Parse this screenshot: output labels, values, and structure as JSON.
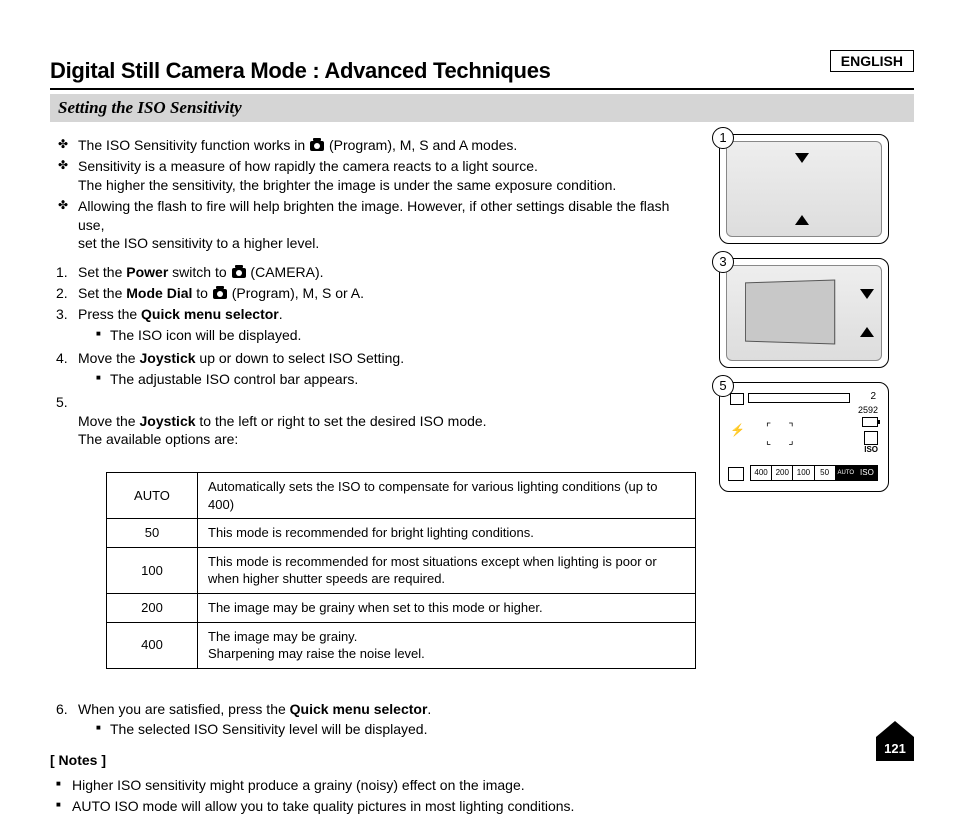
{
  "language_label": "ENGLISH",
  "title": "Digital Still Camera Mode : Advanced Techniques",
  "subhead": "Setting the ISO Sensitivity",
  "intro": [
    "The ISO Sensitivity function works in     (Program), M, S and A modes.",
    "Sensitivity is a measure of how rapidly the camera reacts to a light source.\nThe higher the sensitivity, the brighter the image is under the same exposure condition.",
    "Allowing the flash to fire will help brighten the image. However, if other settings disable the flash use,\nset the ISO sensitivity to a higher level."
  ],
  "steps": {
    "s1": {
      "pre": "Set the ",
      "b": "Power",
      "post": " switch to      (CAMERA)."
    },
    "s2": {
      "pre": "Set the ",
      "b": "Mode Dial",
      "post": " to      (Program), M, S or A."
    },
    "s3": {
      "pre": "Press the ",
      "b": "Quick menu selector",
      "post": ".",
      "sub": "The ISO icon will be displayed."
    },
    "s4": {
      "pre": "Move the ",
      "b": "Joystick",
      "post": " up or down to select ISO Setting.",
      "sub": "The adjustable ISO control bar appears."
    },
    "s5": {
      "pre": "Move the ",
      "b": "Joystick",
      "post": " to the left or right to set the desired ISO mode.\nThe available options are:"
    },
    "s6": {
      "pre": "When you are satisfied, press the ",
      "b": "Quick menu selector",
      "post": ".",
      "sub": "The selected ISO Sensitivity level will be displayed."
    }
  },
  "table": [
    {
      "k": "AUTO",
      "v": "Automatically sets the ISO to compensate for various lighting conditions (up to 400)"
    },
    {
      "k": "50",
      "v": "This mode is recommended for bright lighting conditions."
    },
    {
      "k": "100",
      "v": "This mode is recommended for most situations except when lighting is poor or when higher shutter speeds are required."
    },
    {
      "k": "200",
      "v": "The image may be grainy when set to this mode or higher."
    },
    {
      "k": "400",
      "v": "The image may be grainy.\nSharpening may raise the noise level."
    }
  ],
  "notes_head": "[ Notes ]",
  "notes": [
    "Higher ISO sensitivity might produce a grainy (noisy) effect on the image.",
    "AUTO ISO mode will allow you to take quality pictures in most lighting conditions."
  ],
  "diagrams": {
    "d1": "1",
    "d3": "3",
    "d5": "5"
  },
  "lcd": {
    "n2": "2",
    "res": "2592",
    "iso_label": "ISO",
    "strip": [
      "400",
      "200",
      "100",
      "50",
      "AUTO",
      "ISO"
    ]
  },
  "page_number": "121"
}
